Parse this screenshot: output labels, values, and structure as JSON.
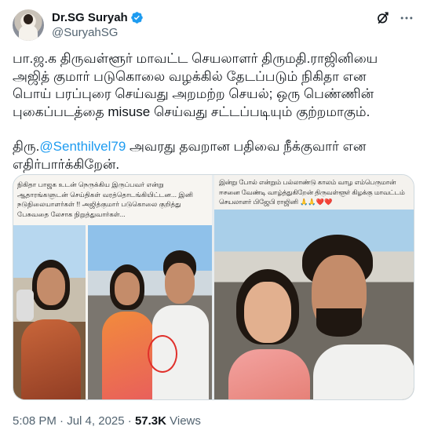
{
  "author": {
    "display_name": "Dr.SG Suryah",
    "handle": "@SuryahSG"
  },
  "icons": {
    "verified": "verified-badge-icon",
    "grok": "grok-icon",
    "more": "more-options-icon",
    "accent_color": "#1d9bf0"
  },
  "tweet": {
    "line1": "பா.ஜ.க திருவள்ளூர் மாவட்ட செயலாளர் திருமதி.ராஜினியை",
    "line2": "அஜித் குமார் படுகொலை வழக்கில் தேடப்படும் நிகிதா என",
    "line3": "பொய் பரப்புரை செய்வது அறமற்ற செயல்; ஒரு பெண்ணின்",
    "line4": "புகைப்படத்தை misuse செய்வது சட்டப்படியும் குற்றமாகும்.",
    "line5_prefix": "திரு.",
    "mention": "@Senthilvel79",
    "line5_suffix": " அவரது தவறான பதிவை நீக்குவார் என",
    "line6": "எதிர்பார்க்கிறேன்."
  },
  "media": {
    "left_caption": "நிகிதா பாஜக உடன் நெருக்கிய இருப்பவர் என்று ஆதாரங்களுடன் செய்திகள் வரத்தொடங்கியிட்டன... இனி நடுநிலையாளர்கள் !! அஜித்குமார் படுகொலை குறித்து பேசுவதை லேசாக நிறுத்துவார்கள்...",
    "right_caption": "இன்று போல் என்றும் பல்லாண்டு காலம் வாழ எம்பெருமான் ஈசனை வேண்டி வாழ்த்துகிறேன் திருவள்ளூர் கிழக்கு மாவட்டம் செயலாளர் பிஜேபி ராஜினி 🙏🙏❤️❤️"
  },
  "meta": {
    "time": "5:08 PM",
    "separator": " · ",
    "date": "Jul 4, 2025",
    "dot": " · ",
    "views_count": "57.3K",
    "views_label": " Views"
  }
}
